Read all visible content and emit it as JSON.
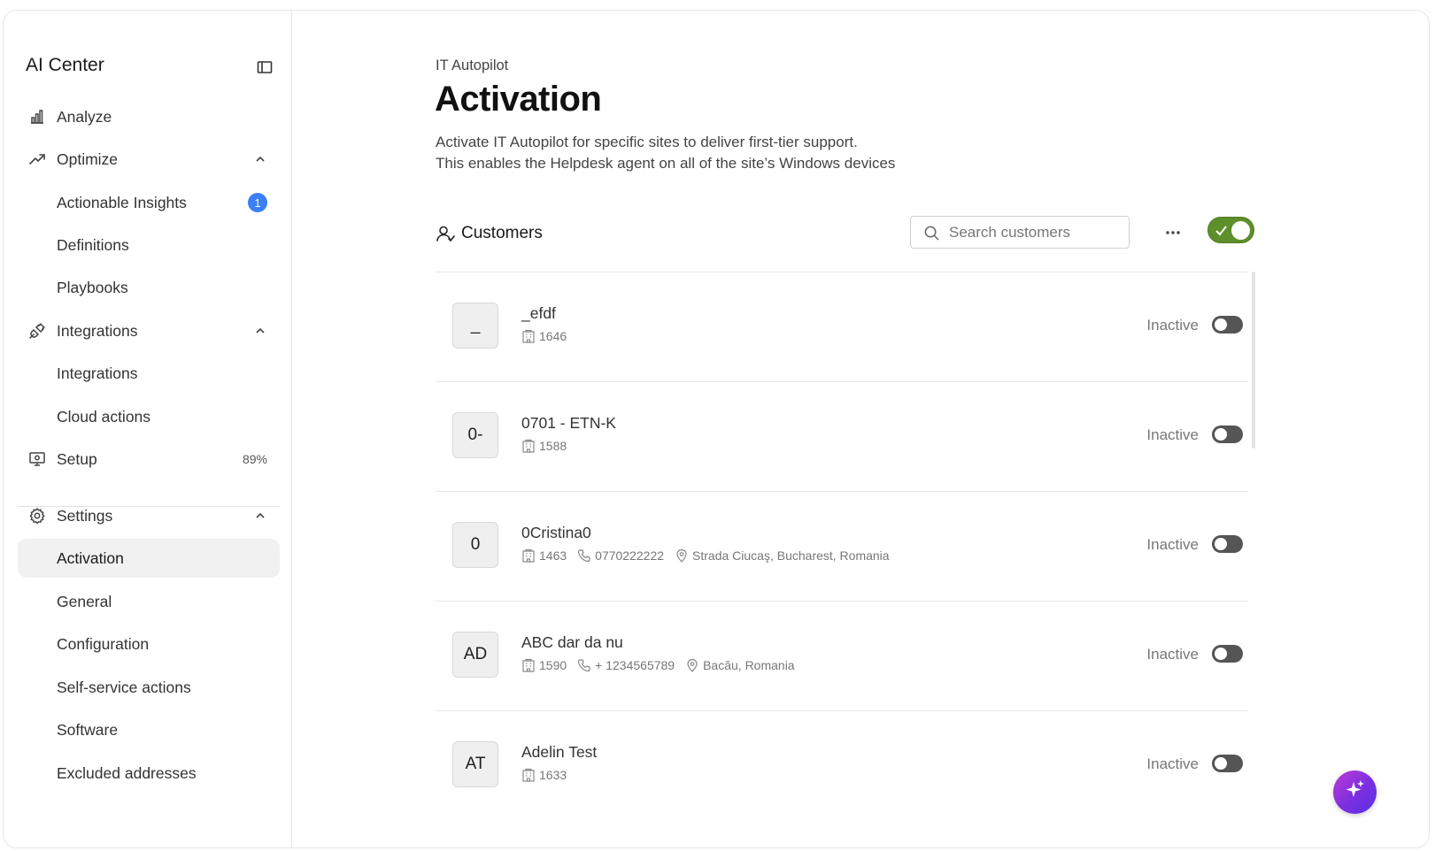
{
  "sidebar": {
    "title": "AI Center",
    "items": [
      {
        "label": "Analyze",
        "icon": "bar-chart-icon"
      },
      {
        "label": "Optimize",
        "icon": "trend-up-icon"
      },
      {
        "label": "Actionable Insights",
        "badge": "1"
      },
      {
        "label": "Definitions"
      },
      {
        "label": "Playbooks"
      },
      {
        "label": "Integrations",
        "icon": "plug-icon"
      },
      {
        "label": "Integrations"
      },
      {
        "label": "Cloud actions"
      },
      {
        "label": "Setup",
        "icon": "monitor-gear-icon",
        "progress": "89%"
      },
      {
        "label": "Settings",
        "icon": "gear-icon"
      },
      {
        "label": "Activation"
      },
      {
        "label": "General"
      },
      {
        "label": "Configuration"
      },
      {
        "label": "Self-service actions"
      },
      {
        "label": "Software"
      },
      {
        "label": "Excluded addresses"
      }
    ]
  },
  "main": {
    "breadcrumb": "IT Autopilot",
    "title": "Activation",
    "description_line1": "Activate IT Autopilot for specific sites to deliver first-tier support.",
    "description_line2": "This enables the Helpdesk agent on all of the site’s Windows devices",
    "customers_label": "Customers",
    "search_placeholder": "Search customers",
    "master_toggle_on": true,
    "accent_color": "#5e8f2b"
  },
  "customers": [
    {
      "initials": "_",
      "name": "_efdf",
      "id": "1646",
      "phone": "",
      "location": "",
      "status": "Inactive"
    },
    {
      "initials": "0-",
      "name": "0701 - ETN-K",
      "id": "1588",
      "phone": "",
      "location": "",
      "status": "Inactive"
    },
    {
      "initials": "0",
      "name": "0Cristina0",
      "id": "1463",
      "phone": "0770222222",
      "location": "Strada Ciucaş, Bucharest, Romania",
      "status": "Inactive"
    },
    {
      "initials": "AD",
      "name": "ABC dar da nu",
      "id": "1590",
      "phone": "+ 1234565789",
      "location": "Bacău, Romania",
      "status": "Inactive"
    },
    {
      "initials": "AT",
      "name": "Adelin Test",
      "id": "1633",
      "phone": "",
      "location": "",
      "status": "Inactive"
    }
  ]
}
